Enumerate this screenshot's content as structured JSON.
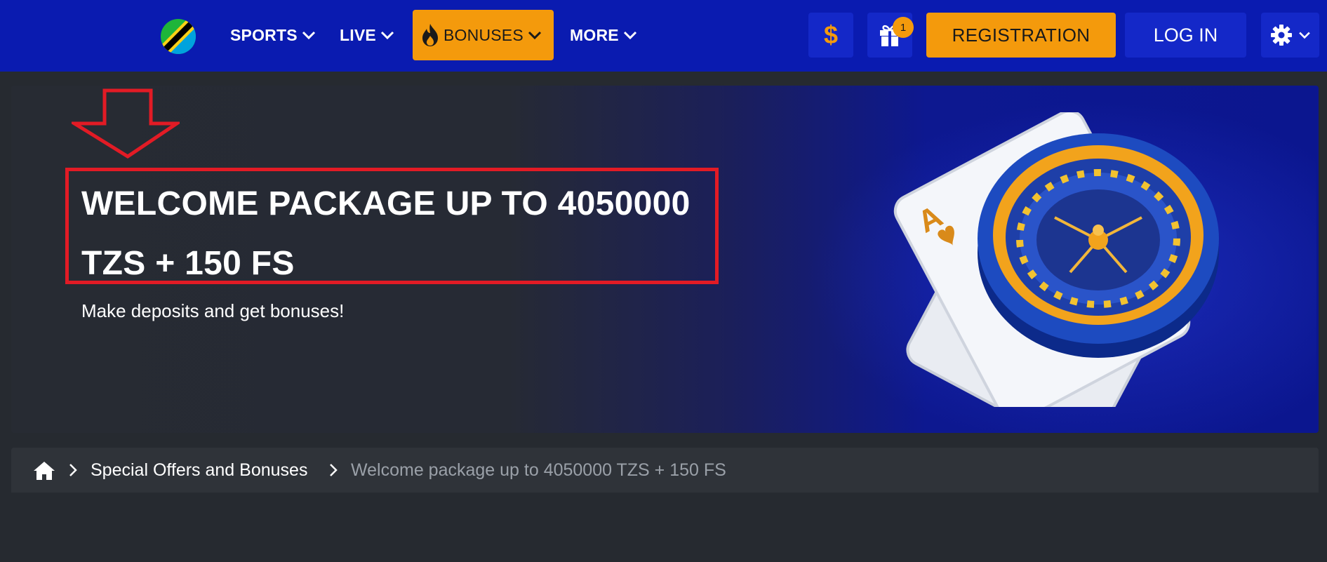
{
  "header": {
    "nav": {
      "sports": "SPORTS",
      "live": "LIVE",
      "bonuses": "BONUSES",
      "more": "MORE"
    },
    "currency_symbol": "$",
    "gift_badge_count": "1",
    "register_label": "REGISTRATION",
    "login_label": "LOG IN"
  },
  "banner": {
    "title": "WELCOME PACKAGE UP TO 4050000 TZS + 150 FS",
    "subtitle": "Make deposits and get bonuses!"
  },
  "breadcrumb": {
    "link": "Special Offers and Bonuses",
    "current": "Welcome package up to 4050000 TZS + 150 FS"
  },
  "colors": {
    "header_bg": "#0a1bb0",
    "accent_orange": "#f49a0c",
    "highlight_red": "#e21b25",
    "page_bg": "#262a30"
  }
}
